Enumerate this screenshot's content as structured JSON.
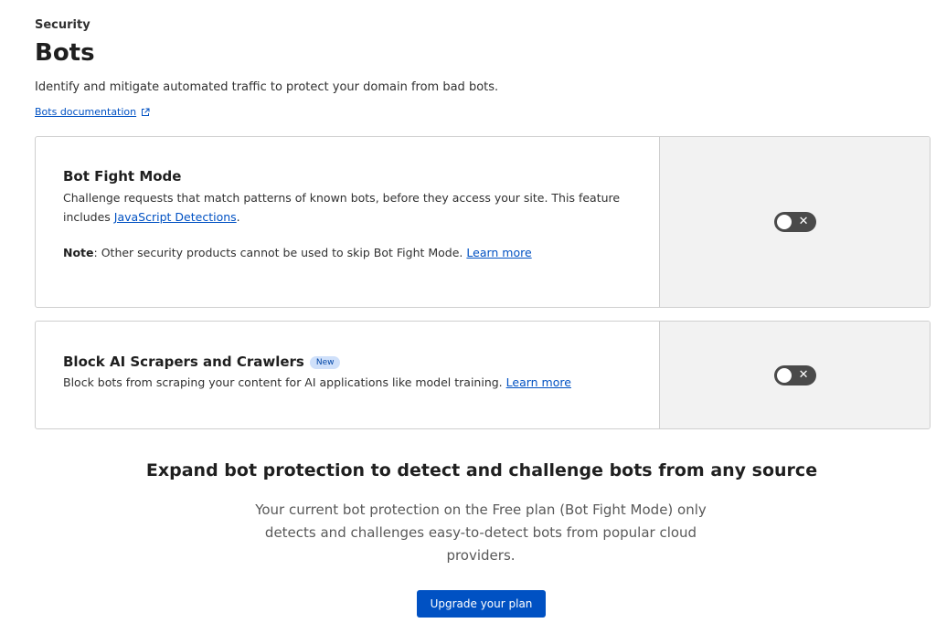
{
  "header": {
    "eyebrow": "Security",
    "title": "Bots",
    "description": "Identify and mitigate automated traffic to protect your domain from bad bots.",
    "doc_link": "Bots documentation",
    "doc_link_icon": "external-link-icon"
  },
  "cards": {
    "bot_fight": {
      "title": "Bot Fight Mode",
      "text_before": "Challenge requests that match patterns of known bots, before they access your site. This feature includes ",
      "link": "JavaScript Detections",
      "text_after": ".",
      "note_label": "Note",
      "note_text": ": Other security products cannot be used to skip Bot Fight Mode. ",
      "note_link": "Learn more",
      "toggle_on": false,
      "toggle_glyph": "✕"
    },
    "ai_scrapers": {
      "title": "Block AI Scrapers and Crawlers",
      "badge": "New",
      "text": "Block bots from scraping your content for AI applications like model training. ",
      "link": "Learn more",
      "toggle_on": false,
      "toggle_glyph": "✕"
    }
  },
  "promo": {
    "title": "Expand bot protection to detect and challenge bots from any source",
    "text": "Your current bot protection on the Free plan (Bot Fight Mode) only detects and challenges easy-to-detect bots from popular cloud providers.",
    "button": "Upgrade your plan"
  },
  "colors": {
    "link": "#0051c3",
    "button": "#0051c3",
    "toggle_off": "#4a4a4a",
    "badge_bg": "#cfe0fa",
    "side_panel": "#f2f2f2"
  }
}
